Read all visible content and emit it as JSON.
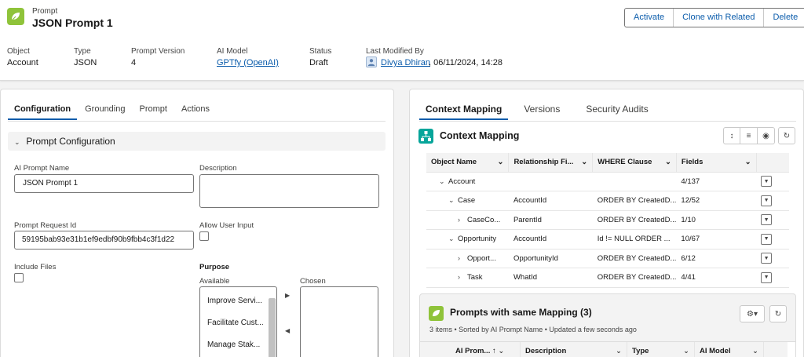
{
  "record": {
    "object_label": "Prompt",
    "title": "JSON Prompt 1",
    "actions": [
      "Activate",
      "Clone with Related",
      "Delete"
    ]
  },
  "highlights": [
    {
      "label": "Object",
      "value": "Account"
    },
    {
      "label": "Type",
      "value": "JSON"
    },
    {
      "label": "Prompt Version",
      "value": "4"
    },
    {
      "label": "AI Model",
      "value": "GPTfy (OpenAI)"
    },
    {
      "label": "Status",
      "value": "Draft"
    },
    {
      "label": "Last Modified By",
      "value": "Divya Dhiran",
      "suffix": ", 06/11/2024, 14:28"
    }
  ],
  "left_tabs": [
    "Configuration",
    "Grounding",
    "Prompt",
    "Actions"
  ],
  "config": {
    "section_title": "Prompt Configuration",
    "ai_prompt_name_label": "AI Prompt Name",
    "ai_prompt_name_value": "JSON Prompt 1",
    "description_label": "Description",
    "prompt_request_id_label": "Prompt Request Id",
    "prompt_request_id_value": "59195bab93e31b1ef9edbf90b9fbb4c3f1d22",
    "allow_user_input_label": "Allow User Input",
    "include_files_label": "Include Files",
    "purpose_label": "Purpose",
    "available_label": "Available",
    "chosen_label": "Chosen",
    "available_items": [
      "Improve Servi...",
      "Facilitate Cust...",
      "Manage Stak..."
    ]
  },
  "right_tabs": [
    "Context Mapping",
    "Versions",
    "Security Audits"
  ],
  "context_mapping": {
    "title": "Context Mapping",
    "columns": [
      "Object Name",
      "Relationship Fi...",
      "WHERE Clause",
      "Fields"
    ],
    "rows": [
      {
        "name": "Account",
        "rel": "",
        "where": "",
        "fields": "4/137"
      },
      {
        "name": "Case",
        "rel": "AccountId",
        "where": "ORDER BY CreatedD...",
        "fields": "12/52"
      },
      {
        "name": "CaseCo...",
        "rel": "ParentId",
        "where": "ORDER BY CreatedD...",
        "fields": "1/10"
      },
      {
        "name": "Opportunity",
        "rel": "AccountId",
        "where": "Id != NULL ORDER ...",
        "fields": "10/67"
      },
      {
        "name": "Opport...",
        "rel": "OpportunityId",
        "where": "ORDER BY CreatedD...",
        "fields": "6/12"
      },
      {
        "name": "Task",
        "rel": "WhatId",
        "where": "ORDER BY CreatedD...",
        "fields": "4/41"
      }
    ]
  },
  "prompts_same": {
    "title": "Prompts with same Mapping (3)",
    "meta": "3 items • Sorted by AI Prompt Name • Updated a few seconds ago",
    "columns": [
      "AI Prom...",
      "Description",
      "Type",
      "AI Model"
    ]
  }
}
